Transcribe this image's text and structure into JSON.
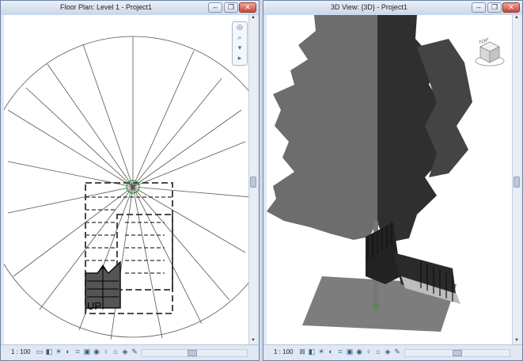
{
  "left_view": {
    "title": "Floor Plan: Level 1 - Project1",
    "scale": "1 : 100",
    "stair_label": "UP"
  },
  "right_view": {
    "title": "3D View: {3D} - Project1",
    "scale": "1 : 100",
    "viewcube_label": "TOP"
  },
  "window_controls": {
    "minimize": "–",
    "restore": "❐",
    "close": "✕"
  },
  "view_control_icons": [
    "detail-level-icon",
    "visual-style-icon",
    "sun-path-icon",
    "shadows-icon",
    "crop-view-icon",
    "show-crop-icon",
    "temporary-hide-icon",
    "reveal-hidden-icon",
    "lock-view-icon",
    "analysis-icon",
    "highlight-icon",
    "more-icon"
  ],
  "colors": {
    "title_bar": "#c9d7e8",
    "close_button": "#c8453a",
    "tree_dark": "#3a3a3a",
    "tree_mid": "#6b6b6b",
    "ground": "#808080"
  }
}
